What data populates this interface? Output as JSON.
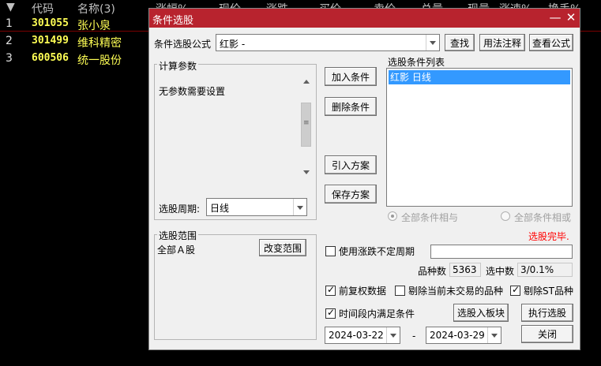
{
  "background": {
    "headers": [
      "代码",
      "名称(3)",
      "涨幅%",
      "现价",
      "涨跌",
      "买价",
      "卖价",
      "总量",
      "现量",
      "涨速%",
      "换手%"
    ],
    "rows": [
      {
        "index": "1",
        "code": "301055",
        "name": "张小泉"
      },
      {
        "index": "2",
        "code": "301499",
        "name": "维科精密"
      },
      {
        "index": "3",
        "code": "600506",
        "name": "统一股份"
      }
    ]
  },
  "dialog": {
    "title": "条件选股",
    "minimize_glyph": "—",
    "close_glyph": "✕",
    "formula_label": "条件选股公式",
    "formula_value": "红影        -",
    "find_button": "查找",
    "usage_button": "用法注释",
    "view_formula_button": "查看公式",
    "params_group_title": "计算参数",
    "params_text": "无参数需要设置",
    "period_label": "选股周期:",
    "period_value": "日线",
    "add_condition_button": "加入条件",
    "delete_condition_button": "删除条件",
    "import_plan_button": "引入方案",
    "save_plan_button": "保存方案",
    "condition_list_title": "选股条件列表",
    "condition_items": [
      "红影  日线"
    ],
    "radio_and_label": "全部条件相与",
    "radio_or_label": "全部条件相或",
    "status_text": "选股完毕.",
    "status_color": "#ff0000",
    "range_group_title": "选股范围",
    "range_value": "全部Ａ股",
    "change_range_button": "改变范围",
    "use_irregular_label": "使用涨跌不定周期",
    "use_irregular_checked": false,
    "irregular_value": "",
    "count_label": "品种数",
    "count_value": "5363",
    "selected_label": "选中数",
    "selected_value": "3/0.1%",
    "prefq_label": "前复权数据",
    "prefq_checked": true,
    "exclude_untraded_label": "剔除当前未交易的品种",
    "exclude_untraded_checked": false,
    "exclude_st_label": "剔除ST品种",
    "exclude_st_checked": true,
    "time_range_label": "时间段内满足条件",
    "time_range_checked": true,
    "to_sector_button": "选股入板块",
    "execute_button": "执行选股",
    "date_from": "2024-03-22",
    "date_sep": "-",
    "date_to": "2024-03-29",
    "close_button": "关闭",
    "title_color": "#b8232e"
  }
}
